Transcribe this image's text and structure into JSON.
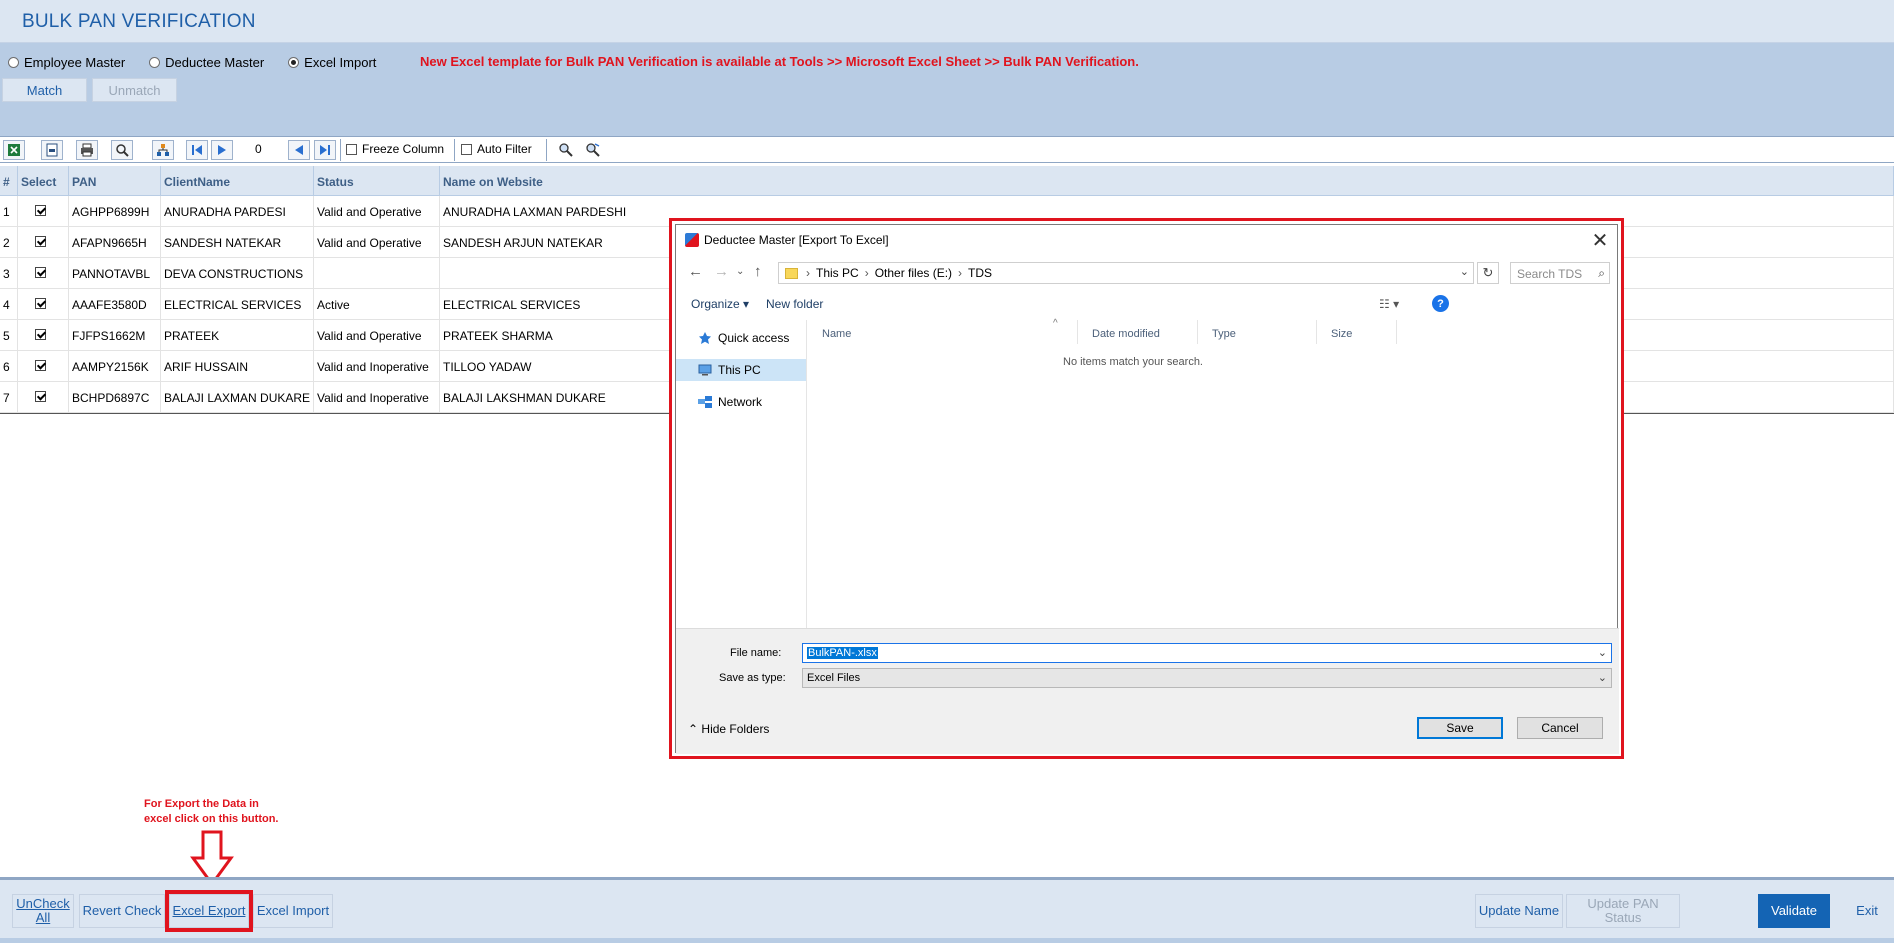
{
  "page": {
    "title": "BULK PAN VERIFICATION"
  },
  "options": {
    "radios": [
      {
        "label": "Employee Master",
        "selected": false
      },
      {
        "label": "Deductee Master",
        "selected": false
      },
      {
        "label": "Excel Import",
        "selected": true
      }
    ],
    "notice": "New Excel template for Bulk PAN Verification is available at Tools >> Microsoft Excel Sheet >> Bulk PAN Verification.",
    "match_label": "Match",
    "unmatch_label": "Unmatch"
  },
  "toolbar": {
    "record_number": "0",
    "freeze_column": "Freeze Column",
    "auto_filter": "Auto Filter",
    "icons": [
      "excel-icon",
      "pdf-icon",
      "print-icon",
      "preview-icon",
      "tree-icon",
      "first-record-icon",
      "next-record-icon",
      "prev-arrow-icon",
      "last-record-icon",
      "find-icon",
      "find-next-icon"
    ]
  },
  "grid": {
    "columns": [
      "#",
      "Select",
      "PAN",
      "ClientName",
      "Status",
      "Name on Website"
    ],
    "rows": [
      {
        "n": "1",
        "pan": "AGHPP6899H",
        "client": "ANURADHA PARDESI",
        "status": "Valid and Operative",
        "website": "ANURADHA LAXMAN PARDESHI"
      },
      {
        "n": "2",
        "pan": "AFAPN9665H",
        "client": "SANDESH NATEKAR",
        "status": "Valid and Operative",
        "website": "SANDESH ARJUN NATEKAR"
      },
      {
        "n": "3",
        "pan": "PANNOTAVBL",
        "client": "DEVA CONSTRUCTIONS",
        "status": "",
        "website": ""
      },
      {
        "n": "4",
        "pan": "AAAFE3580D",
        "client": "ELECTRICAL SERVICES",
        "status": "Active",
        "website": "ELECTRICAL SERVICES"
      },
      {
        "n": "5",
        "pan": "FJFPS1662M",
        "client": "PRATEEK",
        "status": "Valid and Operative",
        "website": "PRATEEK SHARMA"
      },
      {
        "n": "6",
        "pan": "AAMPY2156K",
        "client": "ARIF HUSSAIN",
        "status": "Valid and Inoperative",
        "website": "TILLOO YADAW"
      },
      {
        "n": "7",
        "pan": "BCHPD6897C",
        "client": "BALAJI LAXMAN DUKARE",
        "status": "Valid and Inoperative",
        "website": "BALAJI LAKSHMAN DUKARE"
      }
    ]
  },
  "annotation": {
    "text": "For Export the Data in excel click on this button."
  },
  "bottom": {
    "uncheck_all_1": "UnCheck",
    "uncheck_all_2": "All",
    "revert_check": "Revert Check",
    "excel_export": "Excel Export",
    "excel_import": "Excel Import",
    "update_name": "Update Name",
    "update_pan_status_1": "Update PAN",
    "update_pan_status_2": "Status",
    "validate": "Validate",
    "exit": "Exit"
  },
  "dialog": {
    "title": "Deductee Master [Export To Excel]",
    "breadcrumb": [
      "This PC",
      "Other files (E:)",
      "TDS"
    ],
    "search_placeholder": "Search TDS",
    "organize": "Organize",
    "new_folder": "New folder",
    "nav_items": [
      "Quick access",
      "This PC",
      "Network"
    ],
    "columns": [
      "Name",
      "Date modified",
      "Type",
      "Size"
    ],
    "empty_message": "No items match your search.",
    "file_name_label": "File name:",
    "file_name_value": "BulkPAN-.xlsx",
    "save_type_label": "Save as type:",
    "save_type_value": "Excel Files",
    "hide_folders": "Hide Folders",
    "save": "Save",
    "cancel": "Cancel"
  }
}
